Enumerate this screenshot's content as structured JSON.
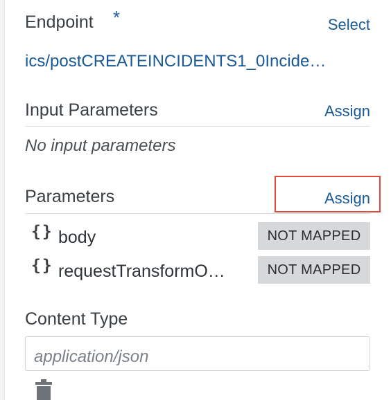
{
  "endpoint": {
    "label": "Endpoint",
    "required_marker": "*",
    "select_label": "Select",
    "value": "ics/postCREATEINCIDENTS1_0Incide…"
  },
  "input_parameters": {
    "label": "Input Parameters",
    "assign_label": "Assign",
    "empty_text": "No input parameters"
  },
  "parameters": {
    "label": "Parameters",
    "assign_label": "Assign",
    "items": [
      {
        "icon": "braces-icon",
        "glyph": "{}",
        "name": "body",
        "status": "NOT MAPPED"
      },
      {
        "icon": "braces-icon",
        "glyph": "{}",
        "name": "requestTransformO…",
        "status": "NOT MAPPED"
      }
    ]
  },
  "content_type": {
    "label": "Content Type",
    "placeholder": "application/json"
  },
  "colors": {
    "link": "#1a5a96",
    "highlight": "#e04a3b",
    "badge_bg": "#d6d8da"
  },
  "icons": {
    "delete": "trash-icon"
  }
}
